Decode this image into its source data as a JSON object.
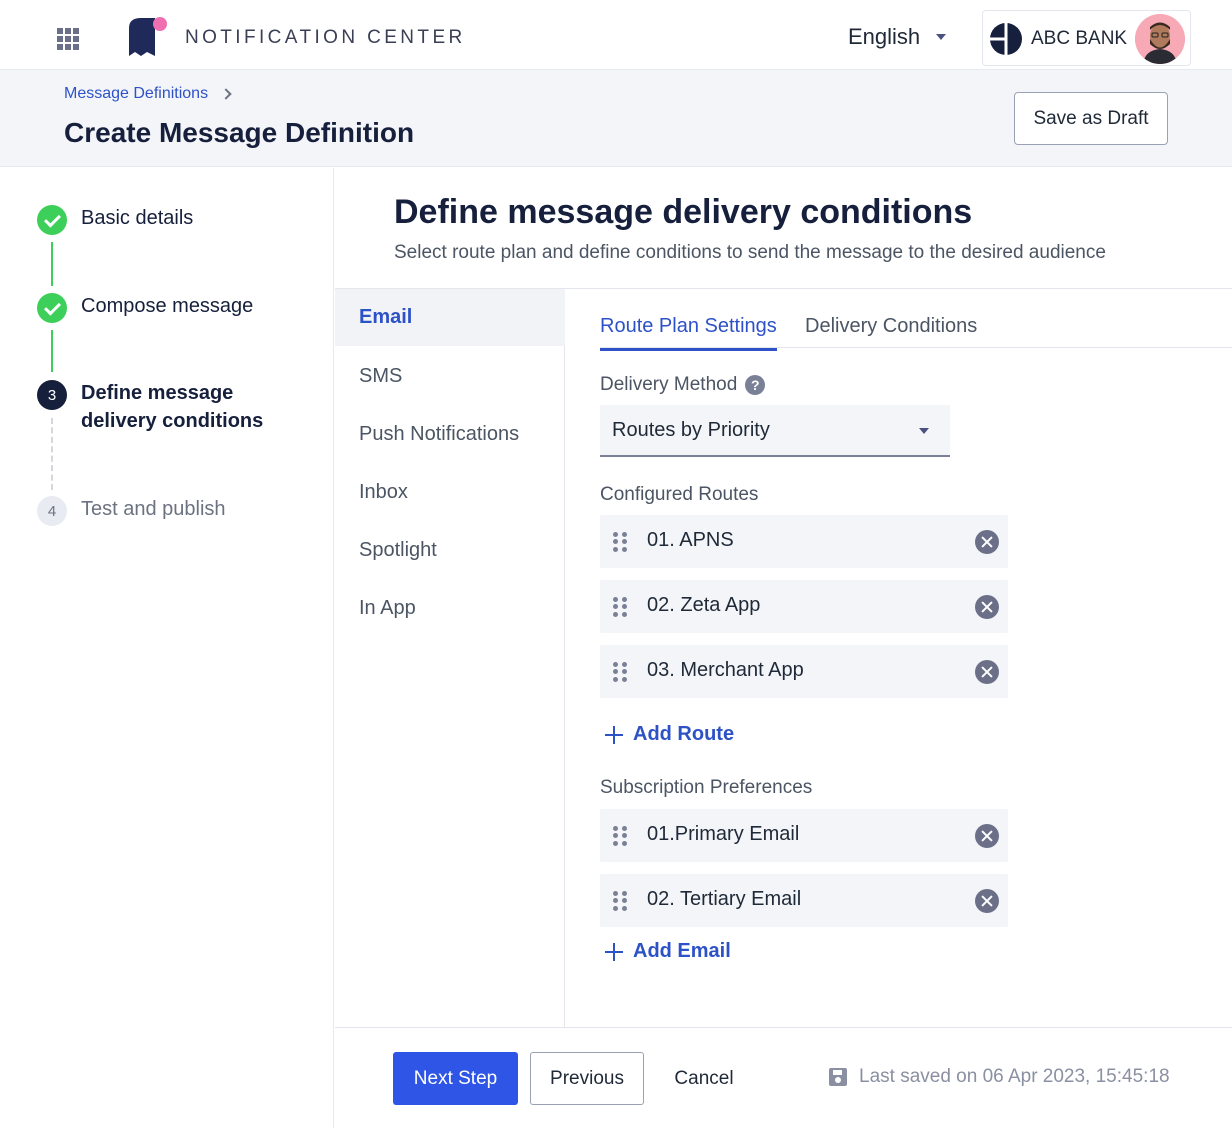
{
  "topbar": {
    "app_title": "NOTIFICATION CENTER",
    "language": "English",
    "bank_name": "ABC BANK"
  },
  "header": {
    "breadcrumb": "Message Definitions",
    "page_title": "Create Message Definition",
    "save_draft_label": "Save as Draft"
  },
  "stepper": {
    "steps": [
      {
        "number": "1",
        "label": "Basic details",
        "status": "done"
      },
      {
        "number": "2",
        "label": "Compose message",
        "status": "done"
      },
      {
        "number": "3",
        "label": "Define message delivery conditions",
        "status": "current"
      },
      {
        "number": "4",
        "label": "Test and publish",
        "status": "todo"
      }
    ]
  },
  "main": {
    "title": "Define message delivery conditions",
    "subtitle": "Select route plan and define conditions to send the message to the desired audience",
    "channels": [
      "Email",
      "SMS",
      "Push Notifications",
      "Inbox",
      "Spotlight",
      "In App"
    ],
    "active_channel": "Email",
    "tabs": [
      "Route Plan Settings",
      "Delivery Conditions"
    ],
    "active_tab": "Route Plan Settings",
    "delivery_method_label": "Delivery Method",
    "help_glyph": "?",
    "delivery_method_value": "Routes by Priority",
    "configured_routes_label": "Configured Routes",
    "routes": [
      "01. APNS",
      "02. Zeta App",
      "03. Merchant App"
    ],
    "add_route_label": "Add Route",
    "subscription_label": "Subscription Preferences",
    "subscriptions": [
      "01.Primary Email",
      "02. Tertiary Email"
    ],
    "add_email_label": "Add Email"
  },
  "footer": {
    "next_label": "Next Step",
    "previous_label": "Previous",
    "cancel_label": "Cancel",
    "last_saved": "Last saved on 06 Apr 2023, 15:45:18"
  },
  "colors": {
    "accent": "#2d52c7",
    "primary_button": "#2e55e6",
    "success": "#3ccf5a",
    "dark": "#16203c"
  }
}
